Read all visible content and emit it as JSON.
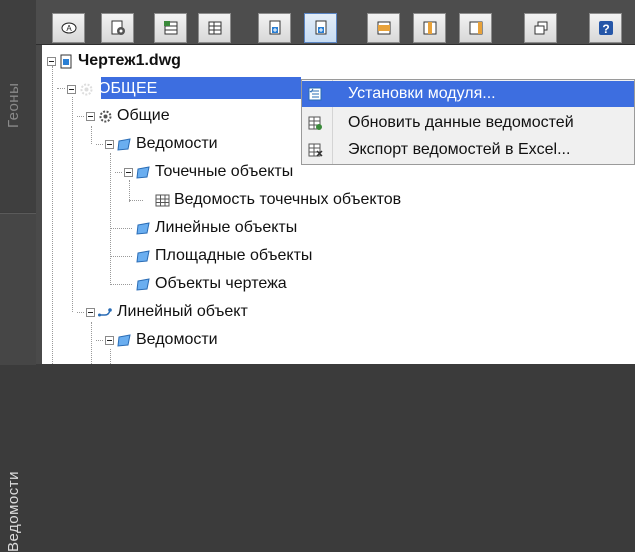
{
  "sidebar": {
    "tabs": [
      {
        "label": "Геоны"
      },
      {
        "label": "Ведомости"
      }
    ]
  },
  "toolbar": {
    "buttons": [
      {
        "name": "toolbar-button-1",
        "icon": "a-icon"
      },
      {
        "name": "toolbar-button-2",
        "icon": "page-gear-icon"
      },
      {
        "name": "toolbar-button-3",
        "icon": "table-add-icon"
      },
      {
        "name": "toolbar-button-4",
        "icon": "table-icon"
      },
      {
        "name": "toolbar-button-5",
        "icon": "page-add-icon"
      },
      {
        "name": "toolbar-button-6",
        "icon": "page-add-active-icon"
      },
      {
        "name": "toolbar-button-7",
        "icon": "layout-icon"
      },
      {
        "name": "toolbar-button-8",
        "icon": "column-icon"
      },
      {
        "name": "toolbar-button-9",
        "icon": "column-right-icon"
      },
      {
        "name": "toolbar-button-10",
        "icon": "window-icon"
      },
      {
        "name": "toolbar-button-11",
        "icon": "help-icon"
      }
    ]
  },
  "tree": {
    "root": {
      "label": "Чертеж1.dwg"
    },
    "items": [
      {
        "label": "ОБЩЕЕ"
      },
      {
        "label": "Общие"
      },
      {
        "label": "Ведомости"
      },
      {
        "label": "Точечные объекты"
      },
      {
        "label": "Ведомость точечных объектов"
      },
      {
        "label": "Линейные объекты"
      },
      {
        "label": "Площадные объекты"
      },
      {
        "label": "Объекты чертежа"
      },
      {
        "label": "Линейный объект"
      },
      {
        "label": "Ведомости"
      }
    ]
  },
  "context_menu": {
    "items": [
      {
        "label": "Установки модуля..."
      },
      {
        "label": "Обновить данные ведомостей"
      },
      {
        "label": "Экспорт ведомостей в Excel..."
      }
    ]
  },
  "colors": {
    "selection": "#3d6ee0",
    "panel": "#ffffff",
    "dark_ui": "#4d4d4d"
  }
}
